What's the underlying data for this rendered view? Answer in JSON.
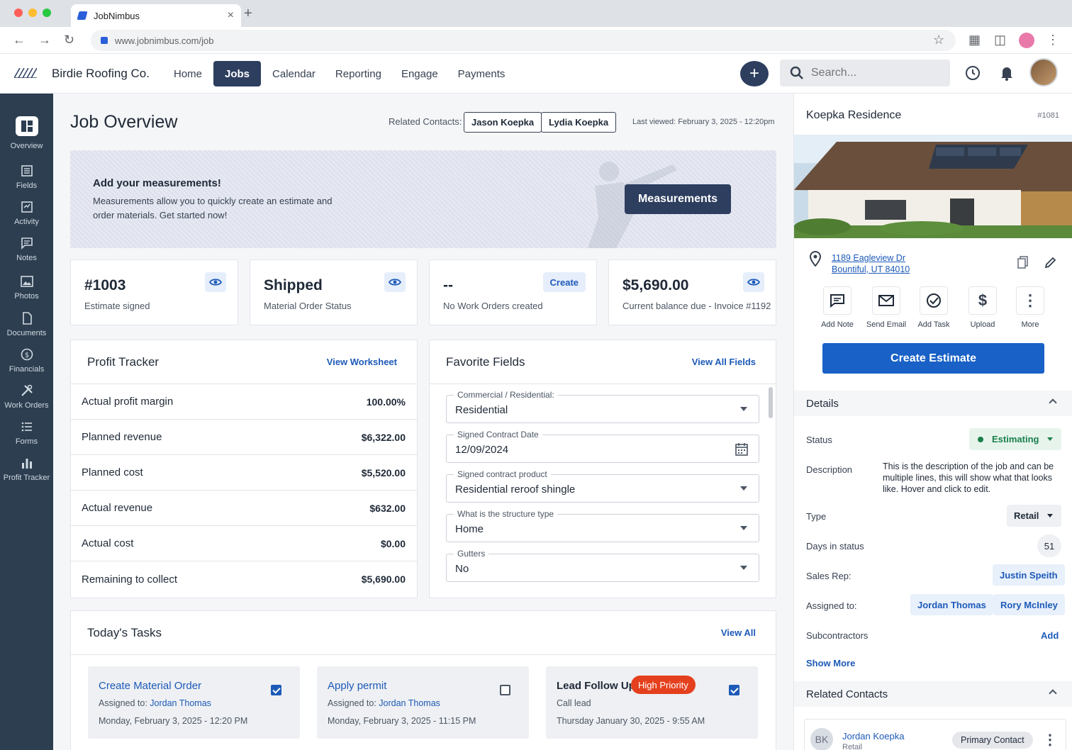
{
  "browser": {
    "tab_title": "JobNimbus",
    "url": "www.jobnimbus.com/job"
  },
  "header": {
    "brand": "Birdie Roofing Co.",
    "nav": [
      "Home",
      "Jobs",
      "Calendar",
      "Reporting",
      "Engage",
      "Payments"
    ],
    "active_nav": "Jobs",
    "search_placeholder": "Search..."
  },
  "sidebar": {
    "items": [
      {
        "label": "Overview",
        "icon": "overview-icon"
      },
      {
        "label": "Fields",
        "icon": "fields-icon"
      },
      {
        "label": "Activity",
        "icon": "activity-icon"
      },
      {
        "label": "Notes",
        "icon": "notes-icon"
      },
      {
        "label": "Photos",
        "icon": "photos-icon"
      },
      {
        "label": "Documents",
        "icon": "documents-icon"
      },
      {
        "label": "Financials",
        "icon": "financials-icon"
      },
      {
        "label": "Work Orders",
        "icon": "work-orders-icon"
      },
      {
        "label": "Forms",
        "icon": "forms-icon"
      },
      {
        "label": "Profit Tracker",
        "icon": "profit-tracker-icon"
      }
    ]
  },
  "main": {
    "title": "Job Overview",
    "related_label": "Related Contacts:",
    "related_contacts": [
      "Jason Koepka",
      "Lydia Koepka"
    ],
    "last_viewed": "Last viewed: February 3, 2025 - 12:20pm",
    "banner": {
      "title": "Add your measurements!",
      "text": "Measurements allow you to quickly create an estimate and order materials.  Get started now!",
      "button": "Measurements"
    },
    "stats": [
      {
        "value": "#1003",
        "label": "Estimate signed",
        "action": "eye"
      },
      {
        "value": "Shipped",
        "label": "Material Order Status",
        "action": "eye"
      },
      {
        "value": "--",
        "label": "No Work Orders created",
        "action": "Create"
      },
      {
        "value": "$5,690.00",
        "label": "Current balance due - Invoice #1192",
        "action": "eye"
      }
    ],
    "profit": {
      "title": "Profit Tracker",
      "link": "View Worksheet",
      "rows": [
        {
          "label": "Actual profit margin",
          "value": "100.00%"
        },
        {
          "label": "Planned revenue",
          "value": "$6,322.00"
        },
        {
          "label": "Planned cost",
          "value": "$5,520.00"
        },
        {
          "label": "Actual revenue",
          "value": "$632.00"
        },
        {
          "label": "Actual cost",
          "value": "$0.00"
        },
        {
          "label": "Remaining to collect",
          "value": "$5,690.00"
        }
      ]
    },
    "favorites": {
      "title": "Favorite Fields",
      "link": "View All Fields",
      "fields": [
        {
          "label": "Commercial / Residential:",
          "value": "Residential",
          "kind": "select"
        },
        {
          "label": "Signed Contract Date",
          "value": "12/09/2024",
          "kind": "date"
        },
        {
          "label": "Signed contract product",
          "value": "Residential reroof shingle",
          "kind": "select"
        },
        {
          "label": "What is the structure type",
          "value": "Home",
          "kind": "select"
        },
        {
          "label": "Gutters",
          "value": "No",
          "kind": "select"
        }
      ]
    },
    "tasks": {
      "title": "Today's Tasks",
      "link": "View All",
      "items": [
        {
          "title": "Create Material Order",
          "assigned_label": "Assigned to:",
          "assignee": "Jordan Thomas",
          "date": "Monday, February 3, 2025 - 12:20 PM",
          "checked": true
        },
        {
          "title": "Apply permit",
          "assigned_label": "Assigned to:",
          "assignee": "Jordan Thomas",
          "date": "Monday, February 3, 2025 - 11:15 PM",
          "checked": false
        },
        {
          "title": "Lead Follow Up",
          "badge": "High Priority",
          "subtitle": "Call lead",
          "date": "Thursday January 30, 2025 - 9:55 AM",
          "checked": true
        }
      ]
    }
  },
  "right": {
    "title": "Koepka Residence",
    "id": "#1081",
    "address_line1": "1189 Eagleview Dr",
    "address_line2": "Bountiful, UT 84010",
    "actions": [
      "Add Note",
      "Send Email",
      "Add Task",
      "Upload",
      "More"
    ],
    "create_estimate": "Create Estimate",
    "details_title": "Details",
    "status_label": "Status",
    "status_value": "Estimating",
    "description_label": "Description",
    "description_value": "This is the description of the job and can be multiple lines, this will show what that looks like.  Hover and click to edit.",
    "type_label": "Type",
    "type_value": "Retail",
    "days_label": "Days in status",
    "days_value": "51",
    "salesrep_label": "Sales Rep:",
    "salesrep_value": "Justin Speith",
    "assigned_label": "Assigned to:",
    "assigned_values": [
      "Jordan Thomas",
      "Rory McInley"
    ],
    "subs_label": "Subcontractors",
    "subs_action": "Add",
    "show_more": "Show More",
    "related_title": "Related Contacts",
    "contact": {
      "initials": "BK",
      "name": "Jordan Koepka",
      "type": "Retail",
      "badge": "Primary Contact"
    }
  },
  "colors": {
    "navy": "#2d3e5f",
    "blue": "#1961c6",
    "sidebar": "#2c3e50",
    "danger": "#e5401d",
    "success": "#1a7f4b"
  }
}
